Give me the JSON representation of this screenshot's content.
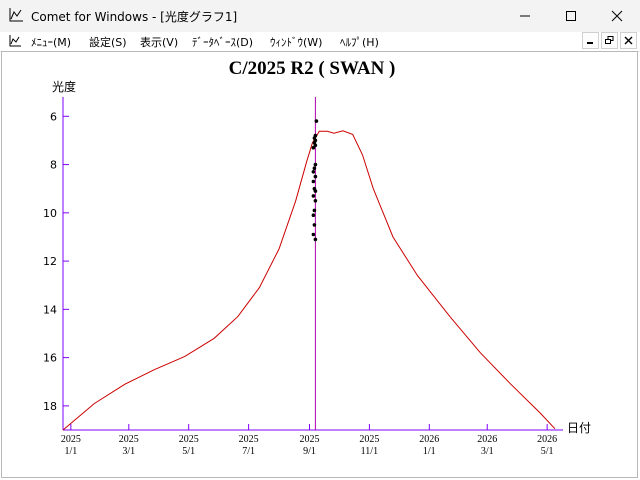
{
  "window": {
    "title": "Comet for Windows - [光度グラフ1]"
  },
  "menu": {
    "items": [
      "ﾒﾆｭｰ(M)",
      "設定(S)",
      "表示(V)",
      "ﾃﾞｰﾀﾍﾞｰｽ(D)",
      "ｳｨﾝﾄﾞｳ(W)",
      "ﾍﾙﾌﾟ(H)"
    ]
  },
  "icons": {
    "app": "graph-app-icon",
    "minimize": "minimize-icon",
    "maximize": "maximize-icon",
    "close": "close-icon",
    "mdi_minimize": "mdi-minimize-icon",
    "mdi_restore": "mdi-restore-icon",
    "mdi_close": "mdi-close-icon"
  },
  "colors": {
    "curve": "#cc0000",
    "axis": "#7f00ff",
    "current_date_line": "#b000b0",
    "observation": "#000000"
  },
  "chart_data": {
    "type": "scatter",
    "title": "C/2025 R2 ( SWAN )",
    "ylabel": "光度",
    "xlabel": "日付",
    "ylim": [
      19,
      5.2
    ],
    "y_inverted": true,
    "y_ticks": [
      6,
      8,
      10,
      12,
      14,
      16,
      18
    ],
    "x_axis_type": "date",
    "xlim": [
      "2024-12-24",
      "2026-05-09"
    ],
    "x_ticks": [
      {
        "date": "2025-01-01",
        "year": "2025",
        "md": "1/1"
      },
      {
        "date": "2025-03-01",
        "year": "2025",
        "md": "3/1"
      },
      {
        "date": "2025-05-01",
        "year": "2025",
        "md": "5/1"
      },
      {
        "date": "2025-07-01",
        "year": "2025",
        "md": "7/1"
      },
      {
        "date": "2025-09-01",
        "year": "2025",
        "md": "9/1"
      },
      {
        "date": "2025-11-01",
        "year": "2025",
        "md": "11/1"
      },
      {
        "date": "2026-01-01",
        "year": "2026",
        "md": "1/1"
      },
      {
        "date": "2026-03-01",
        "year": "2026",
        "md": "3/1"
      },
      {
        "date": "2026-05-01",
        "year": "2026",
        "md": "5/1"
      }
    ],
    "current_date": "2025-09-07",
    "series": [
      {
        "kind": "predicted_curve",
        "points": [
          [
            "2024-12-24",
            19.0
          ],
          [
            "2025-01-25",
            17.9
          ],
          [
            "2025-02-25",
            17.1
          ],
          [
            "2025-03-27",
            16.5
          ],
          [
            "2025-04-27",
            15.95
          ],
          [
            "2025-05-27",
            15.2
          ],
          [
            "2025-06-20",
            14.3
          ],
          [
            "2025-07-12",
            13.1
          ],
          [
            "2025-08-01",
            11.5
          ],
          [
            "2025-08-18",
            9.5
          ],
          [
            "2025-08-29",
            7.9
          ],
          [
            "2025-09-04",
            7.1
          ],
          [
            "2025-09-11",
            6.62
          ],
          [
            "2025-09-19",
            6.62
          ],
          [
            "2025-09-26",
            6.7
          ],
          [
            "2025-10-05",
            6.6
          ],
          [
            "2025-10-15",
            6.75
          ],
          [
            "2025-10-25",
            7.6
          ],
          [
            "2025-11-05",
            9.0
          ],
          [
            "2025-11-25",
            11.0
          ],
          [
            "2025-12-20",
            12.6
          ],
          [
            "2026-01-22",
            14.3
          ],
          [
            "2026-02-22",
            15.8
          ],
          [
            "2026-03-25",
            17.1
          ],
          [
            "2026-04-24",
            18.3
          ],
          [
            "2026-05-09",
            18.95
          ]
        ]
      },
      {
        "kind": "observations",
        "points": [
          [
            "2025-09-08",
            6.2
          ],
          [
            "2025-09-07",
            6.8
          ],
          [
            "2025-09-06",
            6.9
          ],
          [
            "2025-09-07",
            7.0
          ],
          [
            "2025-09-06",
            7.1
          ],
          [
            "2025-09-07",
            7.2
          ],
          [
            "2025-09-05",
            7.3
          ],
          [
            "2025-09-07",
            8.0
          ],
          [
            "2025-09-06",
            8.15
          ],
          [
            "2025-09-05",
            8.3
          ],
          [
            "2025-09-07",
            8.5
          ],
          [
            "2025-09-05",
            8.7
          ],
          [
            "2025-09-06",
            9.0
          ],
          [
            "2025-09-07",
            9.1
          ],
          [
            "2025-09-05",
            9.3
          ],
          [
            "2025-09-07",
            9.5
          ],
          [
            "2025-09-06",
            9.9
          ],
          [
            "2025-09-05",
            10.1
          ],
          [
            "2025-09-06",
            10.5
          ],
          [
            "2025-09-05",
            10.9
          ],
          [
            "2025-09-07",
            11.1
          ]
        ]
      }
    ]
  }
}
